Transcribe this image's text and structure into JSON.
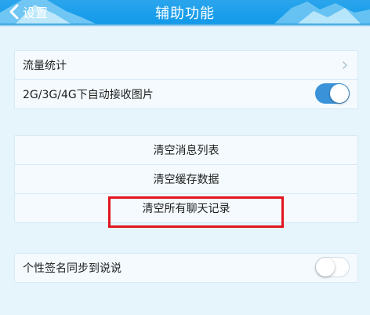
{
  "nav": {
    "back_label": "设置",
    "title": "辅助功能"
  },
  "group1": {
    "traffic_label": "流量统计",
    "auto_receive_label": "2G/3G/4G下自动接收图片",
    "auto_receive_on": true
  },
  "group2": {
    "clear_messages": "清空消息列表",
    "clear_cache": "清空缓存数据",
    "clear_chats": "清空所有聊天记录"
  },
  "group3": {
    "signature_sync_label": "个性签名同步到说说",
    "signature_sync_on": false
  },
  "colors": {
    "nav": "#1a9ce9",
    "toggle_on": "#3a93d9",
    "highlight": "#e2161d"
  }
}
